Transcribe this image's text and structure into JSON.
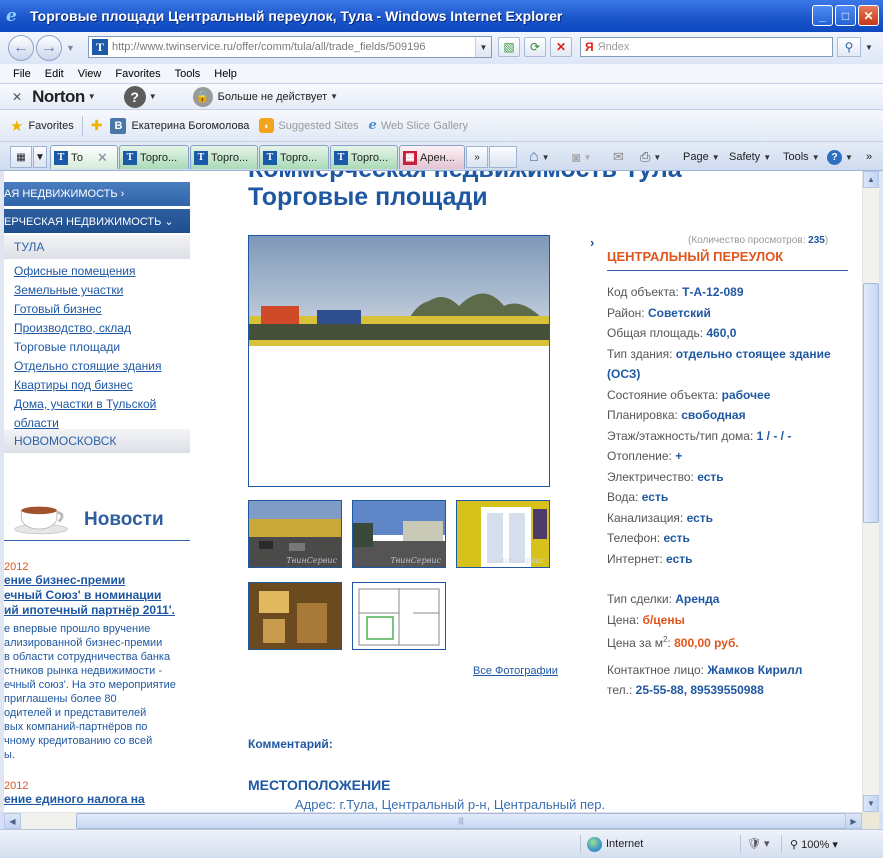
{
  "window": {
    "title": "Торговые площади Центральный переулок, Тула - Windows Internet Explorer"
  },
  "addressbar": {
    "url": "http://www.twinservice.ru/offer/comm/tula/all/trade_fields/509196",
    "search_placeholder": "Яndex",
    "search_engine_logo": "Я"
  },
  "menu": [
    "File",
    "Edit",
    "View",
    "Favorites",
    "Tools",
    "Help"
  ],
  "norton": {
    "brand": "Norton",
    "status": "Больше не действует"
  },
  "favorites_bar": {
    "favorites_label": "Favorites",
    "items": [
      "Екатерина Богомолова",
      "Suggested Sites",
      "Web Slice Gallery"
    ]
  },
  "tabs": {
    "items": [
      "То",
      "Торго...",
      "Торго...",
      "Торго...",
      "Торго...",
      "Арен..."
    ],
    "more": "»"
  },
  "command_bar": {
    "page": "Page",
    "safety": "Safety",
    "tools": "Tools"
  },
  "sidebar": {
    "top_nav": "АЯ НЕДВИЖИМОСТЬ ›",
    "commercial": "ЕРЧЕСКАЯ НЕДВИЖИМОСТЬ ⌄",
    "city": "ТУЛА",
    "links": [
      "Офисные помещения",
      "Земельные участки",
      "Готовый бизнес",
      "Производство, склад",
      "Торговые площади",
      "Отдельно стоящие здания",
      "Квартиры под бизнес",
      "Дома, участки в Тульской области"
    ],
    "city2": "НОВОМОСКОВСК"
  },
  "news": {
    "title": "Новости",
    "items": [
      {
        "date": "2012",
        "headline": "ение бизнес-премии\nечный Союз' в номинации\nий ипотечный партнёр 2011'.",
        "body": "е впервые прошло вручение\nализированной бизнес-премии\n в области сотрудничества банка\nстников рынка недвижимости -\nечный союз'. На это мероприятие\nприглашены более 80\nодителей и представителей\nвых компаний-партнёров по\nчному кредитованию со всей\nы."
      },
      {
        "date": "2012",
        "headline": "ение единого налога на",
        "body": ""
      }
    ]
  },
  "main": {
    "heading_top": "Коммерческая недвижимость Тула",
    "heading": "Торговые площади",
    "all_photos": "Все Фотографии",
    "thumb_caption": "ТвинСервис",
    "views_label": "(Количество просмотров:",
    "views_count": "235",
    "views_close": ")",
    "street": "ЦЕНТРАЛЬНЫЙ ПЕРЕУЛОК",
    "props": {
      "code_label": "Код объекта:",
      "code": "Т-А-12-089",
      "district_label": "Район:",
      "district": "Советский",
      "area_label": "Общая площадь:",
      "area": "460,0",
      "building_label": "Тип здания:",
      "building": "отдельно стоящее здание (ОСЗ)",
      "condition_label": "Состояние объекта:",
      "condition": "рабочее",
      "layout_label": "Планировка:",
      "layout_value": "свободная",
      "floor_label": "Этаж/этажность/тип дома:",
      "floor": "1 / - / -",
      "heating_label": "Отопление:",
      "heating": "+",
      "electricity_label": "Электричество:",
      "electricity": "есть",
      "water_label": "Вода:",
      "water": "есть",
      "sewer_label": "Канализация:",
      "sewer": "есть",
      "phone_line_label": "Телефон:",
      "phone_line": "есть",
      "internet_label": "Интернет:",
      "internet": "есть",
      "deal_label": "Тип сделки:",
      "deal": "Аренда",
      "price_label": "Цена:",
      "price": "б/цены",
      "price_m2_label": "Цена за м",
      "price_m2_sup": "2",
      "price_m2_colon": ":",
      "price_m2": "800,00 руб.",
      "contact_label": "Контактное лицо:",
      "contact": "Жамков Кирилл",
      "tel_label": "тел.:",
      "tel": "25-55-88, 89539550988"
    },
    "comment_label": "Комментарий:",
    "location_heading": "МЕСТОПОЛОЖЕНИЕ",
    "address": "Адрес: г.Тула, Центральный р-н, Центральный пер."
  },
  "statusbar": {
    "zone": "Internet",
    "zoom": "100%"
  }
}
